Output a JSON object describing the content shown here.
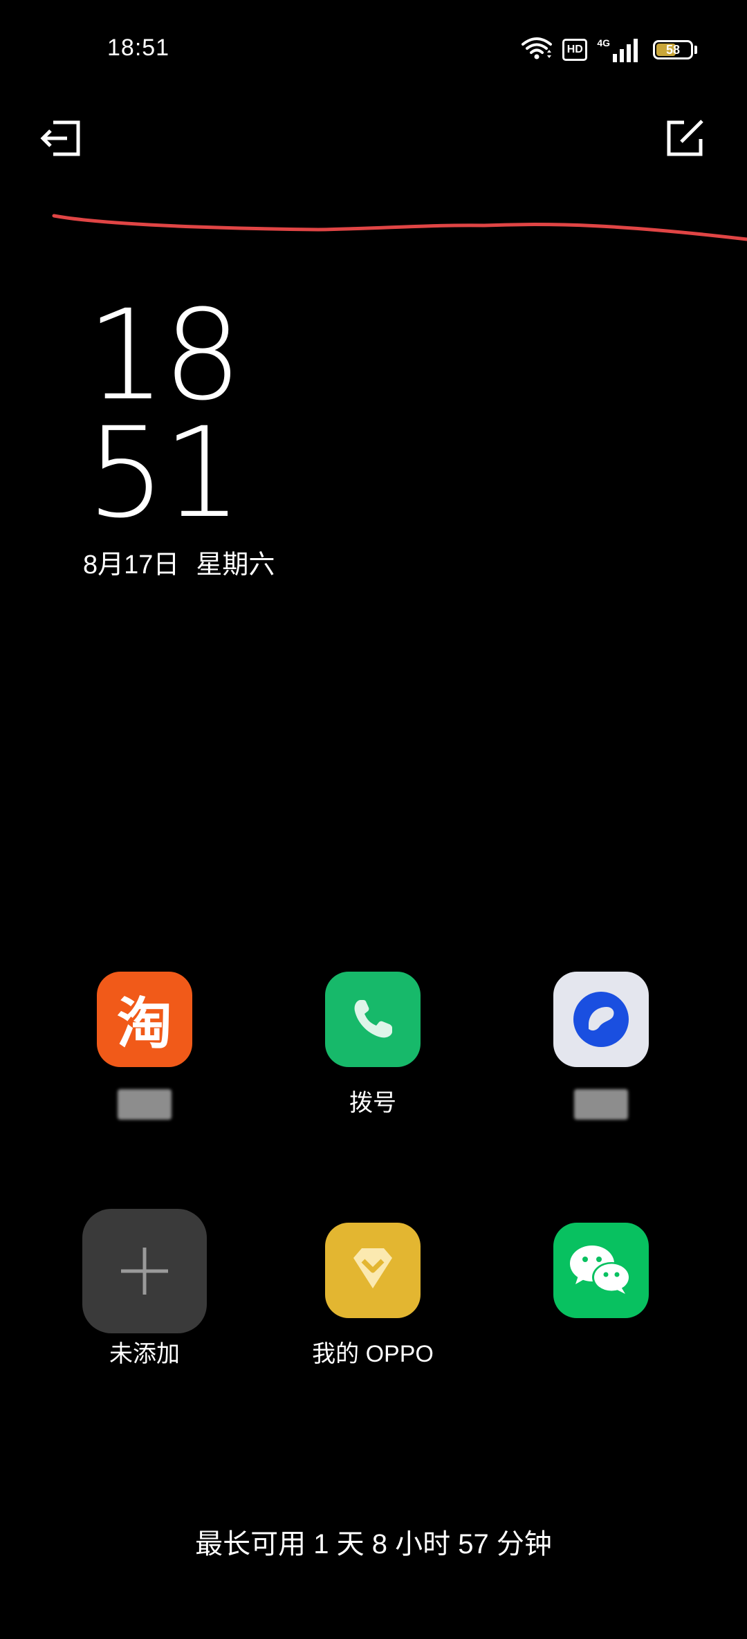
{
  "status_bar": {
    "time": "18:51",
    "hd_label": "HD",
    "network_label": "4G",
    "battery_level": "58",
    "battery_fraction": 0.58,
    "battery_color": "#c9a63a"
  },
  "top_actions": {
    "exit_icon": "exit-icon",
    "edit_icon": "edit-icon"
  },
  "annotation": {
    "stroke_color": "#e04545"
  },
  "clock": {
    "hour": "18",
    "minute": "51",
    "date": "8月17日",
    "weekday": "星期六"
  },
  "apps": [
    {
      "id": "taobao",
      "label": "",
      "icon": "taobao-icon",
      "glyph": "淘",
      "color": "#f15a19"
    },
    {
      "id": "dialer",
      "label": "拨号",
      "icon": "phone-icon",
      "color": "#17b96a"
    },
    {
      "id": "third",
      "label": "",
      "icon": "circle-app-icon",
      "color": "#e4e6ee"
    },
    {
      "id": "add",
      "label": "未添加",
      "icon": "plus-icon",
      "color": "#3a3a3a"
    },
    {
      "id": "myoppo",
      "label": "我的 OPPO",
      "icon": "diamond-icon",
      "color": "#e3b631"
    },
    {
      "id": "wechat",
      "label": "",
      "icon": "wechat-icon",
      "color": "#08c160"
    }
  ],
  "footer": {
    "battery_estimate": "最长可用 1 天 8 小时 57 分钟"
  }
}
